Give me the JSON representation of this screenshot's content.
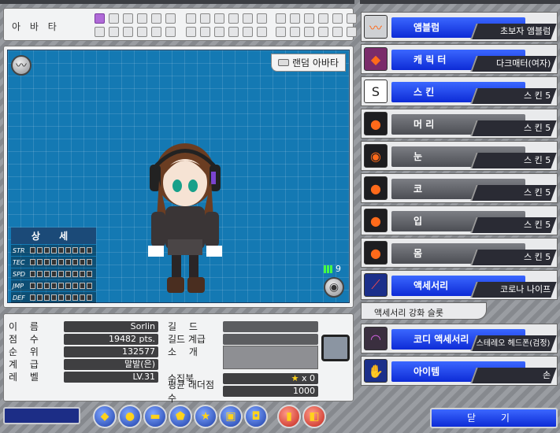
{
  "avatar_tab": {
    "title": "아 바 타"
  },
  "preview": {
    "random_label": "랜덤 아바타",
    "level_badge": "9",
    "stats_title": "상 세",
    "stats": [
      "STR",
      "TEC",
      "SPD",
      "JMP",
      "DEF"
    ]
  },
  "info": {
    "name_label": "이 름",
    "name": "Sorlin",
    "score_label": "점 수",
    "score": "19482 pts.",
    "rank_label": "순 위",
    "rank": "132577",
    "class_label": "계 급",
    "class": "말발(은)",
    "level_label": "레 벨",
    "level": "LV.31",
    "guild_label": "길 드",
    "guild": "",
    "guild_rank_label": "길드 계급",
    "guild_rank": "",
    "intro_label": "소 개",
    "collection_label": "수집북",
    "collection": "x 0",
    "ladder_label": "평균 래더점수",
    "ladder": "1000"
  },
  "equipment": [
    {
      "label": "앰블럼",
      "value": "초보자 앰블럼",
      "icon": "emblem-icon",
      "active": true
    },
    {
      "label": "캐 릭 터",
      "value": "다크매터(여자)",
      "icon": "character-icon",
      "active": true
    },
    {
      "label": "스 킨",
      "value": "스   킨 5",
      "icon": "skin-icon",
      "active": true
    },
    {
      "label": "머 리",
      "value": "스   킨 5",
      "icon": "hair-icon",
      "active": false
    },
    {
      "label": "눈",
      "value": "스   킨 5",
      "icon": "eye-icon",
      "active": false
    },
    {
      "label": "코",
      "value": "스   킨 5",
      "icon": "nose-icon",
      "active": false
    },
    {
      "label": "입",
      "value": "스   킨 5",
      "icon": "mouth-icon",
      "active": false
    },
    {
      "label": "몸",
      "value": "스   킨 5",
      "icon": "body-icon",
      "active": false
    },
    {
      "label": "액세서리",
      "value": "코로나 나이프",
      "icon": "knife-icon",
      "active": true
    }
  ],
  "accessory_slot_label": "액세서리 강화 슬롯",
  "codi_accessory": {
    "label": "코디 액세서리",
    "value": "스테레오 헤드폰(검정)"
  },
  "item": {
    "label": "아이템",
    "value": "손"
  },
  "close_label": "닫 기",
  "colors": {
    "active": "#1d3ee0",
    "inactive": "#5c5e64",
    "grid": "#1479b3"
  }
}
